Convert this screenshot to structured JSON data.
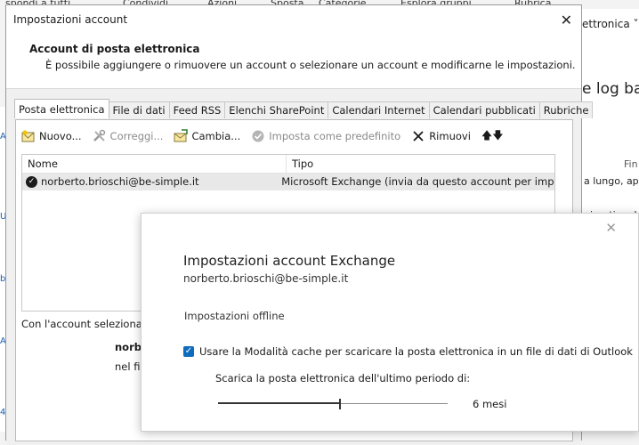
{
  "background": {
    "ribbon": [
      "spondi a tutti",
      "Condividi",
      "Azioni",
      "Sposta",
      "Categorie",
      "Esplora gruppi",
      "Rubrica"
    ],
    "right_texts": [
      "ettronica ˅",
      "e log ba",
      "Fin",
      "a lungo, app",
      "nizzation, L"
    ]
  },
  "main_dialog": {
    "title": "Impostazioni account",
    "close_label": "✕",
    "header_title": "Account di posta elettronica",
    "header_desc": "È possibile aggiungere o rimuovere un account o selezionare un account e modificarne le impostazioni.",
    "tabs": [
      {
        "label": "Posta elettronica",
        "active": true
      },
      {
        "label": "File di dati",
        "active": false
      },
      {
        "label": "Feed RSS",
        "active": false
      },
      {
        "label": "Elenchi SharePoint",
        "active": false
      },
      {
        "label": "Calendari Internet",
        "active": false
      },
      {
        "label": "Calendari pubblicati",
        "active": false
      },
      {
        "label": "Rubriche",
        "active": false
      }
    ],
    "toolbar": {
      "new": "Nuovo...",
      "repair": "Correggi...",
      "change": "Cambia...",
      "default": "Imposta come predefinito",
      "remove": "Rimuovi"
    },
    "grid": {
      "col_name": "Nome",
      "col_type": "Tipo",
      "rows": [
        {
          "name": "norberto.brioschi@be-simple.it",
          "type": "Microsoft Exchange (invia da questo account per imp..."
        }
      ]
    },
    "selected_label": "Con l'account selezionato",
    "selected_name": "norbe",
    "selected_file": "nel fil"
  },
  "exchange_dialog": {
    "close_label": "✕",
    "title": "Impostazioni account Exchange",
    "email": "norberto.brioschi@be-simple.it",
    "offline_heading": "Impostazioni offline",
    "cached_mode_label": "Usare la Modalità cache per scaricare la posta elettronica in un file di dati di Outlook",
    "cached_mode_checked": true,
    "period_label": "Scarica la posta elettronica dell'ultimo periodo di:",
    "period_value": "6 mesi",
    "slider_fraction": 0.53
  }
}
